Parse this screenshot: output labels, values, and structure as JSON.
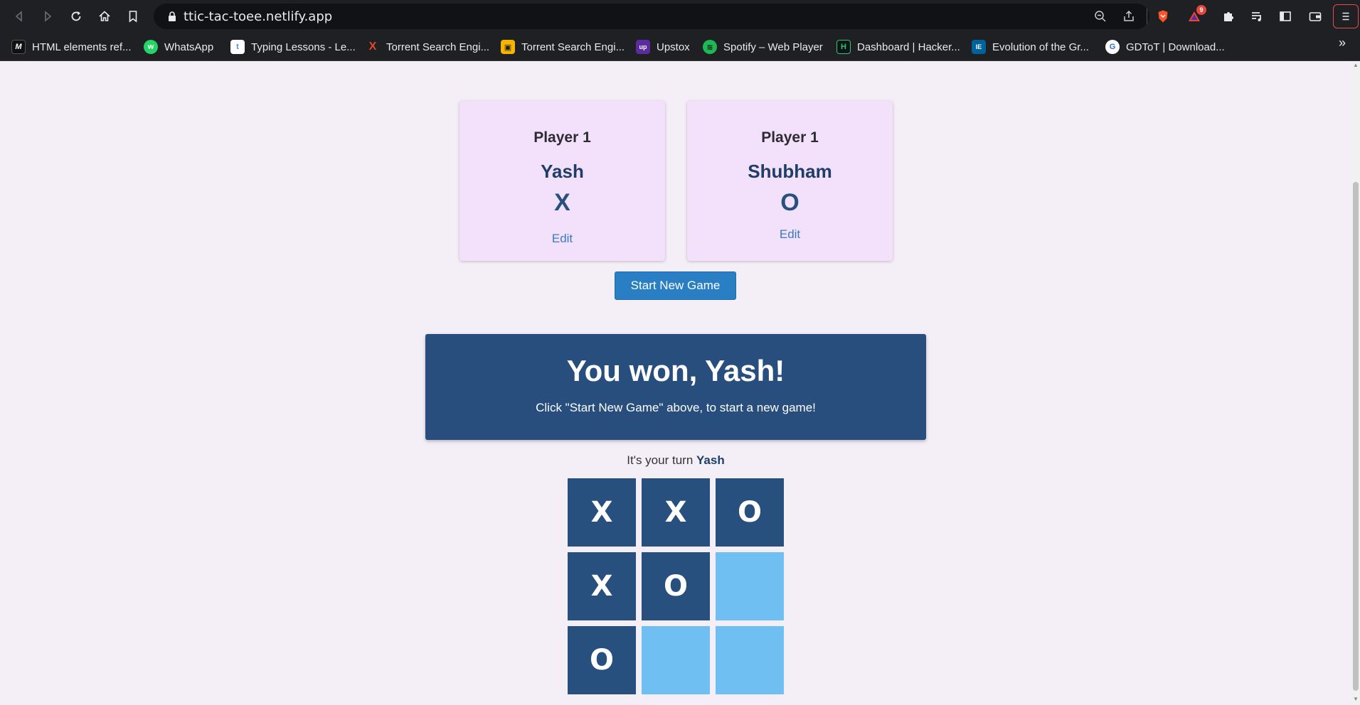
{
  "browser": {
    "url": "ttic-tac-toee.netlify.app",
    "shields_badge": "9",
    "bookmarks": [
      {
        "label": "HTML elements ref...",
        "icon": "mdn-icon",
        "color": "#111111",
        "glyph": "M"
      },
      {
        "label": "WhatsApp",
        "icon": "whatsapp-icon",
        "color": "#25d366",
        "glyph": "w"
      },
      {
        "label": "Typing Lessons - Le...",
        "icon": "typing-icon",
        "color": "#4a90d9",
        "glyph": "t"
      },
      {
        "label": "Torrent Search Engi...",
        "icon": "torrent-x-icon",
        "color": "#e5452a",
        "glyph": "X"
      },
      {
        "label": "Torrent Search Engi...",
        "icon": "torrent-lock-icon",
        "color": "#f4b400",
        "glyph": "🔒"
      },
      {
        "label": "Upstox",
        "icon": "upstox-icon",
        "color": "#5a2ca0",
        "glyph": "up"
      },
      {
        "label": "Spotify – Web Player",
        "icon": "spotify-icon",
        "color": "#1db954",
        "glyph": "≋"
      },
      {
        "label": "Dashboard | Hacker...",
        "icon": "hackerrank-icon",
        "color": "#0e141e",
        "glyph": "H"
      },
      {
        "label": "Evolution of the Gr...",
        "icon": "ieee-icon",
        "color": "#00629b",
        "glyph": "IE"
      },
      {
        "label": "GDToT | Download...",
        "icon": "gdtot-icon",
        "color": "#2d6fd6",
        "glyph": "G"
      }
    ]
  },
  "players": [
    {
      "title": "Player 1",
      "name": "Yash",
      "symbol": "X",
      "edit": "Edit"
    },
    {
      "title": "Player 1",
      "name": "Shubham",
      "symbol": "O",
      "edit": "Edit"
    }
  ],
  "start_button": "Start New Game",
  "result": {
    "title": "You won, Yash!",
    "subtitle": "Click \"Start New Game\" above, to start a new game!"
  },
  "turn": {
    "prefix": "It's your turn",
    "player": "Yash"
  },
  "board": [
    "X",
    "X",
    "O",
    "X",
    "O",
    "",
    "O",
    "",
    ""
  ],
  "colors": {
    "accent": "#2a7fc4",
    "filled_cell": "#27507e",
    "empty_cell": "#6fbff3",
    "card": "#f3e1fb",
    "page_bg": "#f4eef6"
  }
}
